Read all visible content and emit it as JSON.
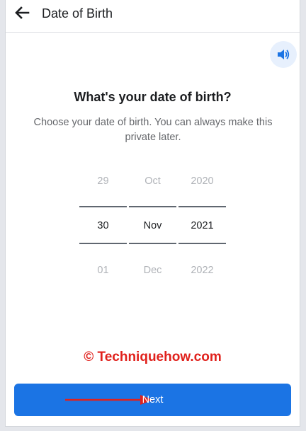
{
  "header": {
    "title": "Date of Birth",
    "back_icon": "arrow-left-icon"
  },
  "speaker_icon": "speaker-icon",
  "prompt": {
    "heading": "What's your date of birth?",
    "subtext": "Choose your date of birth. You can always make this private later."
  },
  "picker": {
    "day": {
      "prev": "29",
      "selected": "30",
      "next": "01"
    },
    "month": {
      "prev": "Oct",
      "selected": "Nov",
      "next": "Dec"
    },
    "year": {
      "prev": "2020",
      "selected": "2021",
      "next": "2022"
    }
  },
  "watermark": "© Techniquehow.com",
  "actions": {
    "next_label": "Next"
  },
  "colors": {
    "primary": "#1b74e4",
    "text": "#1c1e21",
    "muted": "#65676b",
    "dim": "#b0b3b8",
    "annotation": "#e0211c"
  }
}
